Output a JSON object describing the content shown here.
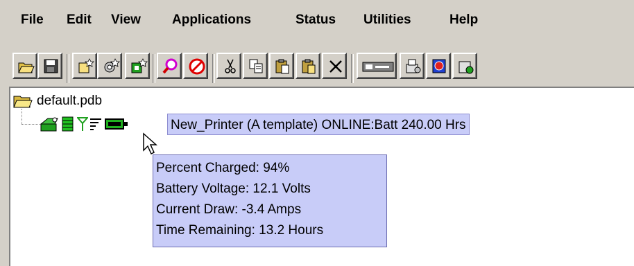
{
  "menu": {
    "file": "File",
    "edit": "Edit",
    "view": "View",
    "applications": "Applications",
    "status": "Status",
    "utilities": "Utilities",
    "help": "Help"
  },
  "toolbar": {
    "icons": [
      "open-folder-icon",
      "save-icon",
      "new-document-icon",
      "new-gear-icon",
      "new-printer-icon",
      "find-icon",
      "stop-icon",
      "cut-icon",
      "copy-icon",
      "paste-icon",
      "paste-special-icon",
      "delete-icon",
      "device-icon",
      "printer-settings-icon",
      "calendar-icon",
      "more-icon"
    ]
  },
  "tree": {
    "root_label": "default.pdb",
    "node_label": "New_Printer (A template) ONLINE:Batt 240.00 Hrs",
    "node_icons": [
      "printer-icon",
      "list-icon",
      "antenna-icon",
      "lines-icon",
      "battery-icon"
    ]
  },
  "tooltip": {
    "percent": "Percent Charged: 94%",
    "voltage": "Battery Voltage: 12.1 Volts",
    "draw": "Current Draw: -3.4 Amps",
    "remaining": "Time Remaining: 13.2 Hours"
  },
  "colors": {
    "window": "#d4d0c8",
    "highlight": "#c8ccf8",
    "tree_bg": "#ffffff"
  }
}
